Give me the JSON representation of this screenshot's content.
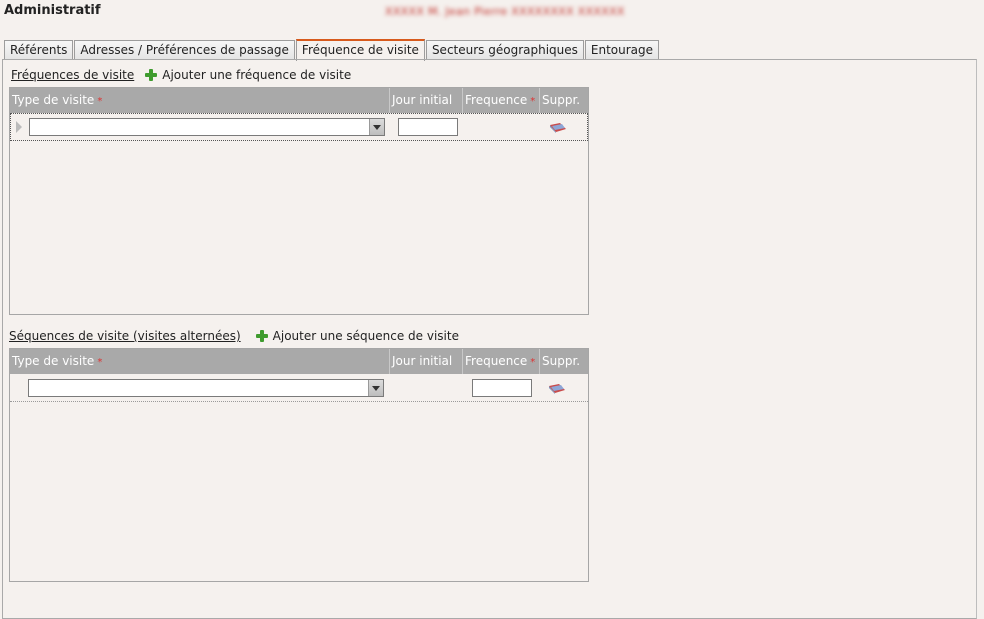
{
  "header": {
    "title": "Administratif",
    "patient_name": "XXXXX M. Jean Pierre XXXXXXXX XXXXXX"
  },
  "tabs": [
    {
      "label": "Référents",
      "active": false
    },
    {
      "label": "Adresses / Préférences de passage",
      "active": false
    },
    {
      "label": "Fréquence de visite",
      "active": true
    },
    {
      "label": "Secteurs géographiques",
      "active": false
    },
    {
      "label": "Entourage",
      "active": false
    }
  ],
  "frequencies": {
    "title": "Fréquences de visite",
    "add_label": "Ajouter une fréquence de visite",
    "columns": {
      "type": "Type de visite",
      "jour_initial": "Jour initial",
      "frequence": "Frequence",
      "suppr": "Suppr."
    },
    "row": {
      "type_value": "",
      "jour_initial_value": ""
    }
  },
  "sequences": {
    "title": "Séquences de visite (visites alternées)",
    "add_label": "Ajouter une séquence de visite",
    "columns": {
      "type": "Type de visite",
      "jour_initial": "Jour initial",
      "frequence": "Frequence",
      "suppr": "Suppr."
    },
    "row": {
      "type_value": "",
      "frequence_value": ""
    }
  },
  "required_marker": "*",
  "colors": {
    "active_tab_accent": "#d75a1c",
    "grid_header": "#a9a9a9",
    "add_icon": "#3f9b2e",
    "required": "#d33333",
    "background": "#f5f1ee"
  },
  "icons": {
    "add": "plus-icon",
    "delete": "eraser-icon",
    "dropdown": "chevron-down-icon"
  }
}
